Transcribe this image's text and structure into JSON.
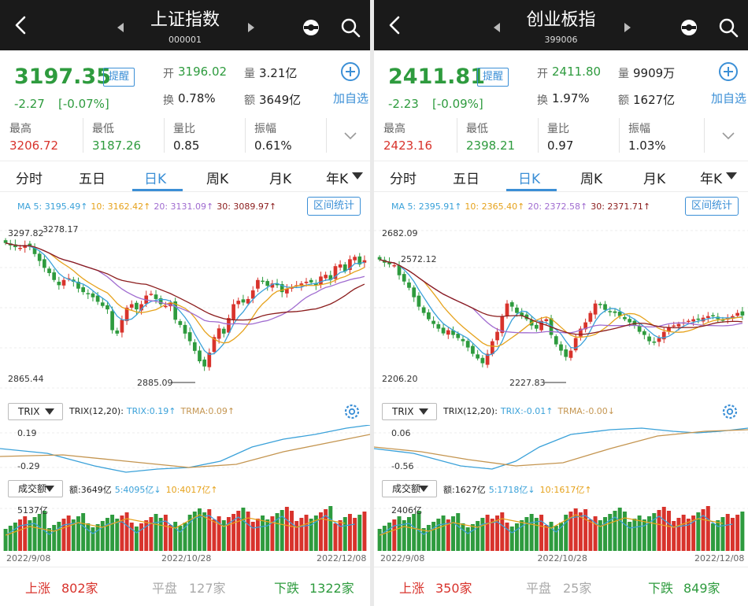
{
  "colors": {
    "up": "#d8332c",
    "down": "#2e9b3e",
    "accent": "#3b8fd6",
    "ma5": "#3aa1d9",
    "ma10": "#e6a21b",
    "ma20": "#a06cd0",
    "ma30": "#8b1c1c",
    "trix": "#3aa1d9",
    "trma": "#c49550"
  },
  "panels": [
    {
      "id": "sh",
      "header": {
        "title": "上证指数",
        "code": "000001"
      },
      "quote": {
        "price": "3197.35",
        "remind_label": "提醒",
        "change": "-2.27",
        "change_pct": "[-0.07%]",
        "open_label": "开",
        "open": "3196.02",
        "volume_label": "量",
        "volume": "3.21亿",
        "turnover_label": "换",
        "turnover": "0.78%",
        "amount_label": "额",
        "amount": "3649亿",
        "add_label": "加自选",
        "stats": [
          {
            "label": "最高",
            "value": "3206.72",
            "tone": "r"
          },
          {
            "label": "最低",
            "value": "3187.26",
            "tone": "g"
          },
          {
            "label": "量比",
            "value": "0.85",
            "tone": ""
          },
          {
            "label": "振幅",
            "value": "0.61%",
            "tone": ""
          }
        ]
      },
      "tabs": [
        "分时",
        "五日",
        "日K",
        "周K",
        "月K",
        "年K"
      ],
      "active_tab": 2,
      "ma": {
        "ma5": "MA 5: 3195.49↑",
        "ma10": "10: 3162.42↑",
        "ma20": "20: 3131.09↑",
        "ma30": "30: 3089.97↑"
      },
      "range_btn": "区间统计",
      "kline_labels": {
        "top_left": "3297.82",
        "top_peak": "3278.17",
        "bottom_left": "2865.44",
        "low": "2885.09"
      },
      "indicator": {
        "select": "TRIX",
        "text": "TRIX(12,20):",
        "trix": "TRIX:0.19↑",
        "trma": "TRMA:0.09↑",
        "top": "0.19",
        "bottom": "-0.29"
      },
      "vol": {
        "select": "成交额",
        "amt": "额:3649亿",
        "v5": "5:4095亿↓",
        "v10": "10:4017亿↑",
        "top": "5137亿"
      },
      "dates": [
        "2022/9/08",
        "2022/10/28",
        "2022/12/08"
      ],
      "footer": {
        "up_label": "上涨",
        "up": "802家",
        "flat_label": "平盘",
        "flat": "127家",
        "down_label": "下跌",
        "down": "1322家"
      },
      "chart_data": {
        "type": "candlestick",
        "high": 3297.82,
        "low": 2865.44,
        "closes": [
          3262,
          3255,
          3250,
          3248,
          3256,
          3252,
          3230,
          3210,
          3190,
          3175,
          3155,
          3140,
          3155,
          3160,
          3150,
          3130,
          3120,
          3115,
          3105,
          3092,
          3080,
          3070,
          3010,
          3000,
          3040,
          3075,
          3085,
          3070,
          3085,
          3110,
          3115,
          3100,
          3085,
          3080,
          3090,
          3040,
          3025,
          3000,
          2978,
          2950,
          2920,
          2905,
          2945,
          2990,
          3015,
          3000,
          3045,
          3085,
          3095,
          3090,
          3100,
          3125,
          3155,
          3150,
          3138,
          3145,
          3140,
          3120,
          3130,
          3135,
          3140,
          3145,
          3150,
          3148,
          3140,
          3165,
          3170,
          3155,
          3195,
          3200,
          3180,
          3215,
          3222,
          3200,
          3212
        ]
      }
    },
    {
      "id": "cy",
      "header": {
        "title": "创业板指",
        "code": "399006"
      },
      "quote": {
        "price": "2411.81",
        "remind_label": "提醒",
        "change": "-2.23",
        "change_pct": "[-0.09%]",
        "open_label": "开",
        "open": "2411.80",
        "volume_label": "量",
        "volume": "9909万",
        "turnover_label": "换",
        "turnover": "1.97%",
        "amount_label": "额",
        "amount": "1627亿",
        "add_label": "加自选",
        "stats": [
          {
            "label": "最高",
            "value": "2423.16",
            "tone": "r"
          },
          {
            "label": "最低",
            "value": "2398.21",
            "tone": "g"
          },
          {
            "label": "量比",
            "value": "0.97",
            "tone": ""
          },
          {
            "label": "振幅",
            "value": "1.03%",
            "tone": ""
          }
        ]
      },
      "tabs": [
        "分时",
        "五日",
        "日K",
        "周K",
        "月K",
        "年K"
      ],
      "active_tab": 2,
      "ma": {
        "ma5": "MA 5: 2395.91↑",
        "ma10": "10: 2365.40↑",
        "ma20": "20: 2372.58↑",
        "ma30": "30: 2371.71↑"
      },
      "range_btn": "区间统计",
      "kline_labels": {
        "top_left": "2682.09",
        "top_peak": "2572.12",
        "bottom_left": "2206.20",
        "low": "2227.83"
      },
      "indicator": {
        "select": "TRIX",
        "text": "TRIX(12,20):",
        "trix": "TRIX:-0.01↑",
        "trma": "TRMA:-0.00↓",
        "top": "0.06",
        "bottom": "-0.56"
      },
      "vol": {
        "select": "成交额",
        "amt": "额:1627亿",
        "v5": "5:1718亿↓",
        "v10": "10:1617亿↑",
        "top": "2406亿"
      },
      "dates": [
        "2022/9/08",
        "2022/10/28",
        "2022/12/08"
      ],
      "footer": {
        "up_label": "上涨",
        "up": "350家",
        "flat_label": "平盘",
        "flat": "25家",
        "down_label": "下跌",
        "down": "849家"
      },
      "chart_data": {
        "type": "candlestick",
        "high": 2682.09,
        "low": 2206.2,
        "closes": [
          2590,
          2580,
          2575,
          2572,
          2540,
          2520,
          2500,
          2470,
          2440,
          2420,
          2400,
          2385,
          2370,
          2355,
          2365,
          2350,
          2340,
          2330,
          2310,
          2290,
          2275,
          2260,
          2290,
          2330,
          2360,
          2410,
          2450,
          2440,
          2420,
          2410,
          2400,
          2380,
          2370,
          2395,
          2400,
          2350,
          2320,
          2300,
          2280,
          2300,
          2340,
          2370,
          2390,
          2420,
          2450,
          2445,
          2430,
          2425,
          2420,
          2410,
          2400,
          2390,
          2380,
          2360,
          2350,
          2330,
          2325,
          2340,
          2360,
          2375,
          2380,
          2385,
          2390,
          2395,
          2400,
          2398,
          2405,
          2410,
          2412,
          2400,
          2395,
          2405,
          2410,
          2420,
          2412
        ]
      }
    }
  ]
}
